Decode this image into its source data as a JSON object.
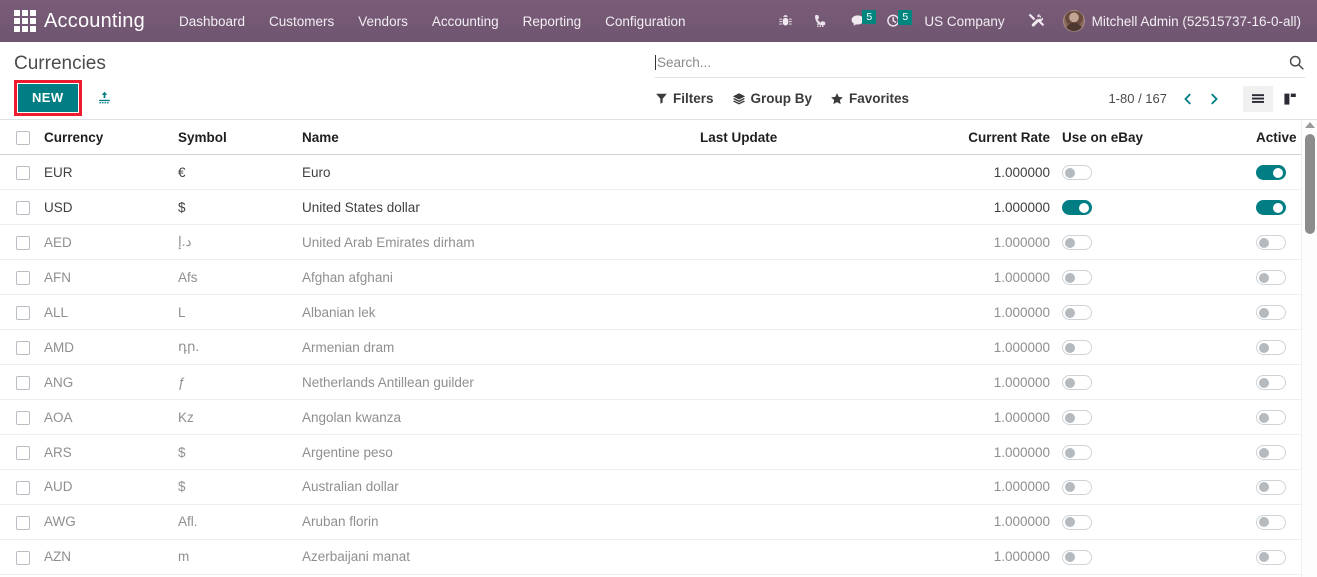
{
  "navbar": {
    "apps_icon": "apps-grid-icon",
    "brand": "Accounting",
    "menu": [
      {
        "label": "Dashboard"
      },
      {
        "label": "Customers"
      },
      {
        "label": "Vendors"
      },
      {
        "label": "Accounting"
      },
      {
        "label": "Reporting"
      },
      {
        "label": "Configuration"
      }
    ],
    "icons": [
      {
        "name": "bug-icon"
      },
      {
        "name": "phone-dialpad-icon"
      }
    ],
    "messages": {
      "icon": "chat-bubble-icon",
      "count": "5"
    },
    "activities": {
      "icon": "clock-icon",
      "count": "5"
    },
    "company": "US Company",
    "tools_icon": "tools-icon",
    "user": "Mitchell Admin (52515737-16-0-all)",
    "accent": "#6f5570",
    "badge_color": "#00857f"
  },
  "control_panel": {
    "title": "Currencies",
    "new_label": "NEW",
    "new_highlight_color": "#ee1b2e",
    "import_icon": "upload-import-icon",
    "search": {
      "value": "",
      "placeholder": "Search..."
    },
    "search_icon": "search-icon",
    "filters": [
      {
        "label": "Filters",
        "icon": "filter-funnel-icon"
      },
      {
        "label": "Group By",
        "icon": "layers-icon"
      },
      {
        "label": "Favorites",
        "icon": "star-icon"
      }
    ],
    "pager": "1-80 / 167",
    "prev_icon": "chevron-left-icon",
    "next_icon": "chevron-right-icon",
    "views": [
      {
        "name": "list-view",
        "icon": "list-icon",
        "active": true
      },
      {
        "name": "kanban-view",
        "icon": "kanban-icon",
        "active": false
      }
    ]
  },
  "table": {
    "columns": [
      {
        "key": "currency",
        "label": "Currency"
      },
      {
        "key": "symbol",
        "label": "Symbol"
      },
      {
        "key": "name",
        "label": "Name"
      },
      {
        "key": "last_update",
        "label": "Last Update"
      },
      {
        "key": "current_rate",
        "label": "Current Rate"
      },
      {
        "key": "use_on_ebay",
        "label": "Use on eBay"
      },
      {
        "key": "active",
        "label": "Active"
      }
    ],
    "optional_columns_icon": "column-settings-icon",
    "rows": [
      {
        "currency": "EUR",
        "symbol": "€",
        "name": "Euro",
        "last_update": "",
        "current_rate": "1.000000",
        "use_on_ebay": false,
        "active": true
      },
      {
        "currency": "USD",
        "symbol": "$",
        "name": "United States dollar",
        "last_update": "",
        "current_rate": "1.000000",
        "use_on_ebay": true,
        "active": true
      },
      {
        "currency": "AED",
        "symbol": "د.إ",
        "name": "United Arab Emirates dirham",
        "last_update": "",
        "current_rate": "1.000000",
        "use_on_ebay": false,
        "active": false
      },
      {
        "currency": "AFN",
        "symbol": "Afs",
        "name": "Afghan afghani",
        "last_update": "",
        "current_rate": "1.000000",
        "use_on_ebay": false,
        "active": false
      },
      {
        "currency": "ALL",
        "symbol": "L",
        "name": "Albanian lek",
        "last_update": "",
        "current_rate": "1.000000",
        "use_on_ebay": false,
        "active": false
      },
      {
        "currency": "AMD",
        "symbol": "դր.",
        "name": "Armenian dram",
        "last_update": "",
        "current_rate": "1.000000",
        "use_on_ebay": false,
        "active": false
      },
      {
        "currency": "ANG",
        "symbol": "ƒ",
        "name": "Netherlands Antillean guilder",
        "last_update": "",
        "current_rate": "1.000000",
        "use_on_ebay": false,
        "active": false
      },
      {
        "currency": "AOA",
        "symbol": "Kz",
        "name": "Angolan kwanza",
        "last_update": "",
        "current_rate": "1.000000",
        "use_on_ebay": false,
        "active": false
      },
      {
        "currency": "ARS",
        "symbol": "$",
        "name": "Argentine peso",
        "last_update": "",
        "current_rate": "1.000000",
        "use_on_ebay": false,
        "active": false
      },
      {
        "currency": "AUD",
        "symbol": "$",
        "name": "Australian dollar",
        "last_update": "",
        "current_rate": "1.000000",
        "use_on_ebay": false,
        "active": false
      },
      {
        "currency": "AWG",
        "symbol": "Afl.",
        "name": "Aruban florin",
        "last_update": "",
        "current_rate": "1.000000",
        "use_on_ebay": false,
        "active": false
      },
      {
        "currency": "AZN",
        "symbol": "m",
        "name": "Azerbaijani manat",
        "last_update": "",
        "current_rate": "1.000000",
        "use_on_ebay": false,
        "active": false
      }
    ]
  }
}
